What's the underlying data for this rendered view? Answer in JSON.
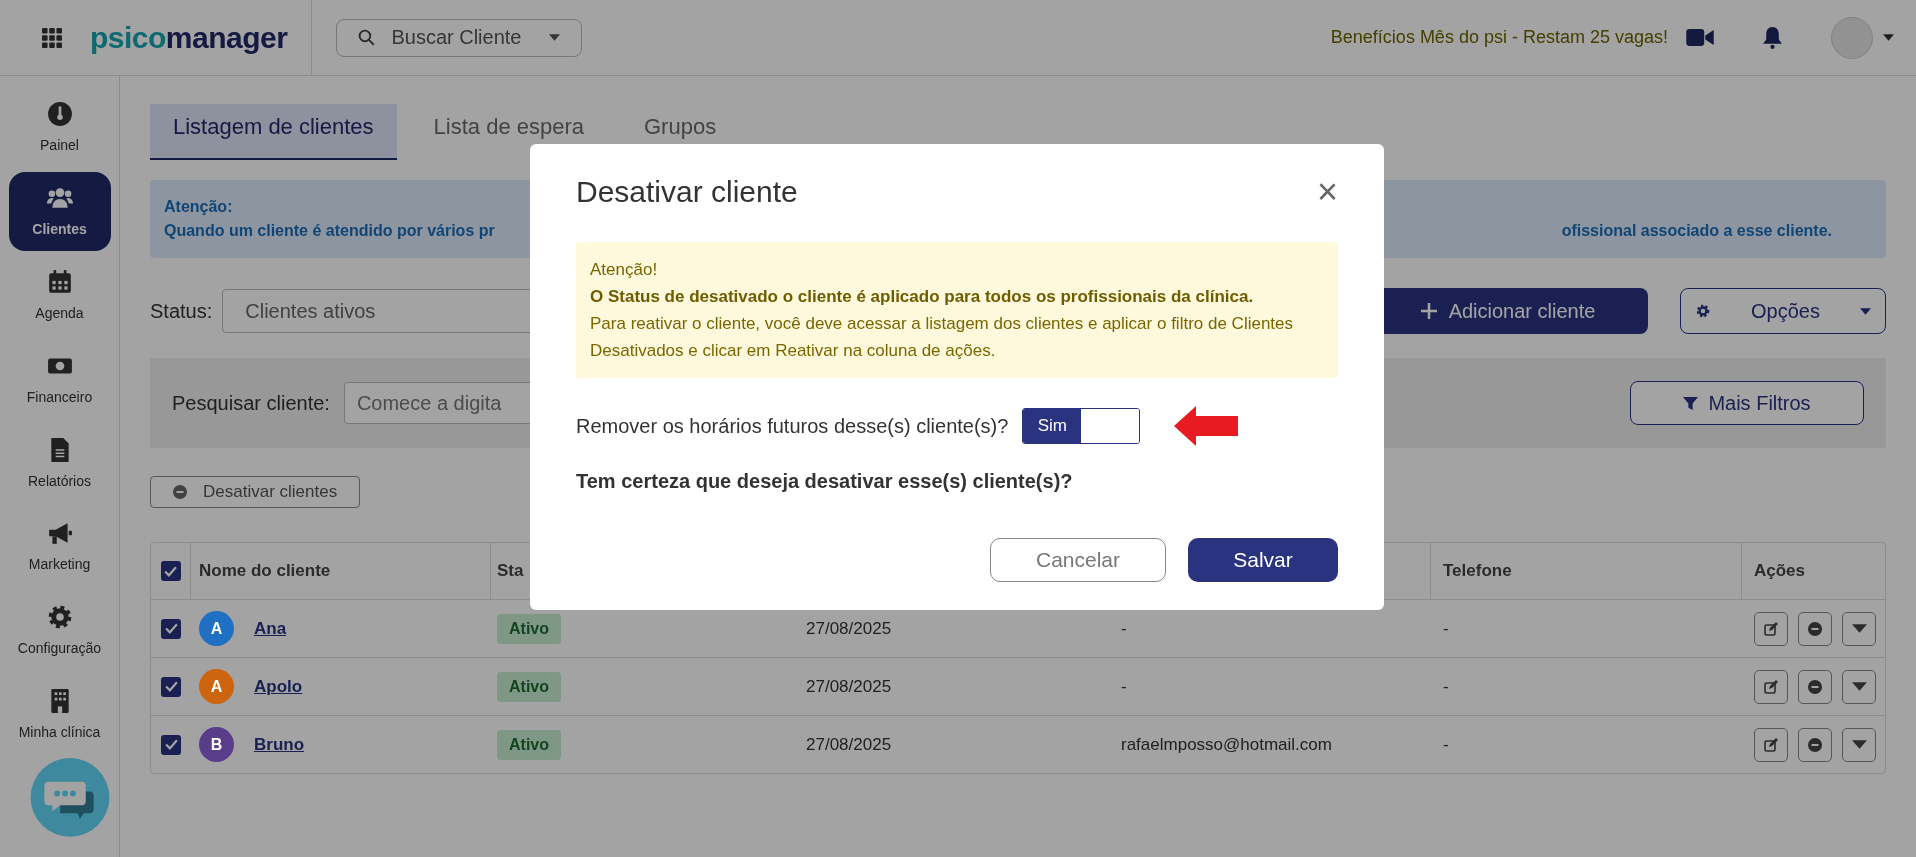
{
  "topbar": {
    "logo": {
      "part1": "psico",
      "part2": "manager"
    },
    "search": {
      "placeholder": "Buscar Cliente"
    },
    "promo": "Benefícios Mês do psi - Restam 25 vagas!"
  },
  "sidebar": {
    "items": [
      {
        "label": "Painel",
        "selected": false
      },
      {
        "label": "Clientes",
        "selected": true
      },
      {
        "label": "Agenda",
        "selected": false
      },
      {
        "label": "Financeiro",
        "selected": false
      },
      {
        "label": "Relatórios",
        "selected": false
      },
      {
        "label": "Marketing",
        "selected": false
      },
      {
        "label": "Configuração",
        "selected": false
      },
      {
        "label": "Minha clínica",
        "selected": false
      }
    ]
  },
  "tabs": [
    {
      "label": "Listagem de clientes",
      "selected": true
    },
    {
      "label": "Lista de espera",
      "selected": false
    },
    {
      "label": "Grupos",
      "selected": false
    }
  ],
  "notice": {
    "title": "Atenção:",
    "text_start": "Quando um cliente é atendido por vários pr",
    "text_end": "ofissional associado a esse cliente."
  },
  "status_filter": {
    "label": "Status:",
    "value": "Clientes ativos"
  },
  "add_button": "Adicionar cliente",
  "options_button": "Opções",
  "search_panel": {
    "label": "Pesquisar cliente:",
    "placeholder": "Comece a digita",
    "filters_button": "Mais Filtros"
  },
  "deactivate_button": "Desativar clientes",
  "table": {
    "all_checked": true,
    "columns": [
      "Nome do cliente",
      "Sta",
      "Telefone",
      "Ações"
    ],
    "rows": [
      {
        "checked": true,
        "initial": "A",
        "color": "#1f6fc2",
        "name": "Ana",
        "status": "Ativo",
        "date": "27/08/2025",
        "email": "-",
        "phone": "-"
      },
      {
        "checked": true,
        "initial": "A",
        "color": "#cc6410",
        "name": "Apolo",
        "status": "Ativo",
        "date": "27/08/2025",
        "email": "-",
        "phone": "-"
      },
      {
        "checked": true,
        "initial": "B",
        "color": "#5a3d8a",
        "name": "Bruno",
        "status": "Ativo",
        "date": "27/08/2025",
        "email": "rafaelmposso@hotmail.com",
        "phone": "-"
      }
    ]
  },
  "modal": {
    "title": "Desativar cliente",
    "close": "×",
    "alert": {
      "heading": "Atenção!",
      "bold": "O Status de desativado o cliente é aplicado para todos os profissionais da clínica.",
      "text": "Para reativar o cliente, você deve acessar a listagem dos clientes e aplicar o filtro de Clientes Desativados e clicar em Reativar na coluna de ações."
    },
    "question": "Remover os horários futuros desse(s) cliente(s)?",
    "toggle": {
      "label": "Sim",
      "on": true
    },
    "confirm": "Tem certeza que deseja desativar esse(s) cliente(s)?",
    "cancel": "Cancelar",
    "save": "Salvar"
  }
}
